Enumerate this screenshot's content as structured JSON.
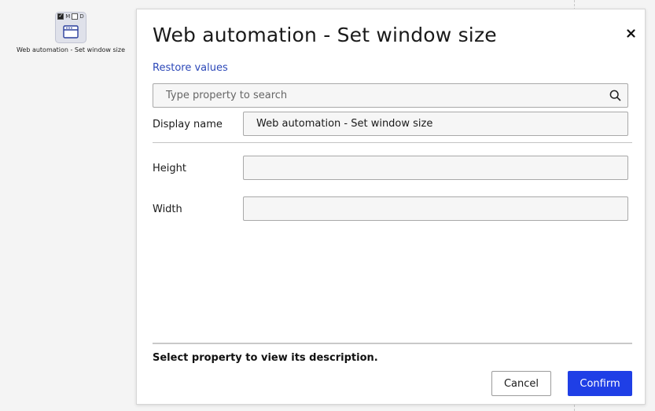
{
  "canvas": {
    "node": {
      "flags": [
        {
          "label": "M",
          "checked": true
        },
        {
          "label": "D",
          "checked": false
        }
      ],
      "icon": "browser-window-icon",
      "label": "Web automation - Set window size"
    }
  },
  "dialog": {
    "title": "Web automation - Set window size",
    "close_icon": "close-icon",
    "restore_link": "Restore values",
    "search": {
      "placeholder": "Type property to search",
      "value": "",
      "icon": "search-icon"
    },
    "properties": {
      "display_name": {
        "label": "Display name",
        "value": "Web automation - Set window size"
      },
      "height": {
        "label": "Height",
        "value": ""
      },
      "width": {
        "label": "Width",
        "value": ""
      }
    },
    "description": "Select property to view its description.",
    "buttons": {
      "cancel": "Cancel",
      "confirm": "Confirm"
    },
    "colors": {
      "accent": "#1f3fe6",
      "link": "#2c48b8"
    }
  }
}
